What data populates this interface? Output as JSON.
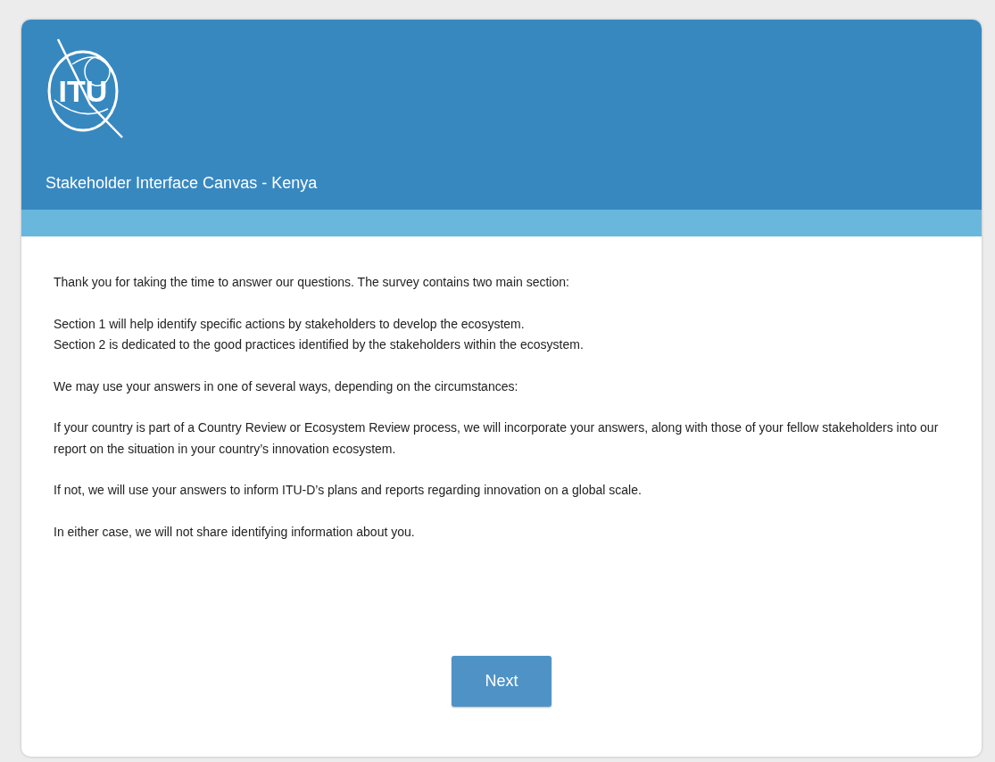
{
  "header": {
    "logo_text": "ITU",
    "title": "Stakeholder Interface Canvas - Kenya"
  },
  "paragraphs": [
    [
      "Thank you for taking the time to answer our questions. The survey contains two main section:"
    ],
    [
      "Section 1 will help identify specific actions by stakeholders to develop the ecosystem.",
      "Section 2 is dedicated to the good practices identified by the stakeholders within the ecosystem."
    ],
    [
      "We may use your answers in one of several ways, depending on the circumstances:"
    ],
    [
      "If your country is part of a Country Review or Ecosystem Review process, we will incorporate your answers, along with those of your fellow stakeholders into our report on the situation in your country’s innovation ecosystem."
    ],
    [
      "If not, we will use your answers to inform ITU-D’s plans and reports regarding innovation on a global scale."
    ],
    [
      "In either case, we will not share identifying information about you."
    ]
  ],
  "buttons": [
    "Next"
  ]
}
